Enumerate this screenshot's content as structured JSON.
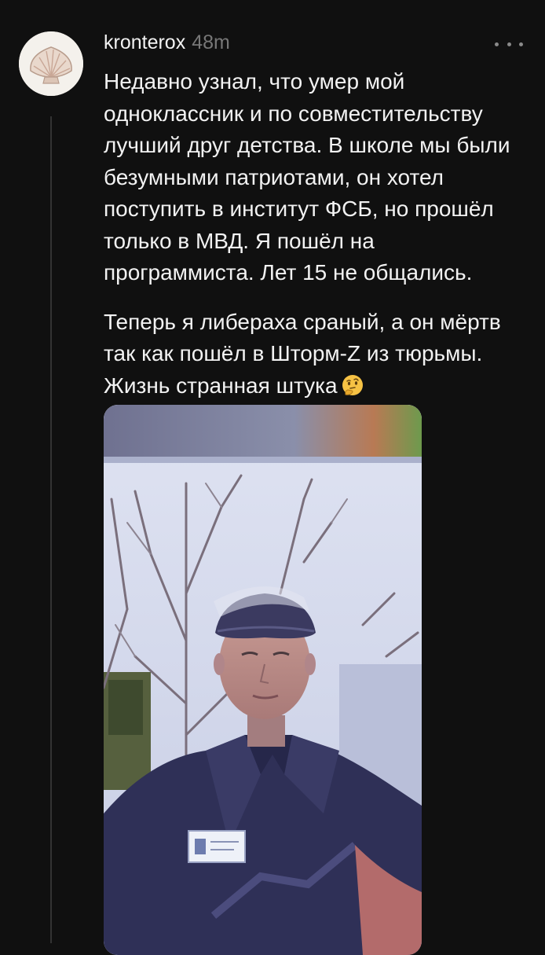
{
  "post": {
    "username": "kronterox",
    "time_ago": "48m",
    "avatar_icon": "seashell-icon",
    "more_icon": "ellipsis-icon",
    "paragraph1": "Недавно узнал, что умер мой одноклассник и по совместительству лучший друг детства. В школе мы были безумными патриотами, он хотел поступить в институт ФСБ, но прошёл только в МВД. Я пошёл на программиста. Лет 15 не общались.",
    "paragraph2": "Теперь я либераха сраный, а он мёртв так как пошёл в Шторм-Z из тюрьмы. Жизнь странная штука",
    "emoji_icon": "thinking-face-icon"
  },
  "colors": {
    "background": "#101010",
    "text": "#f2f2f2",
    "muted": "#777777",
    "thread_line": "#333333"
  }
}
